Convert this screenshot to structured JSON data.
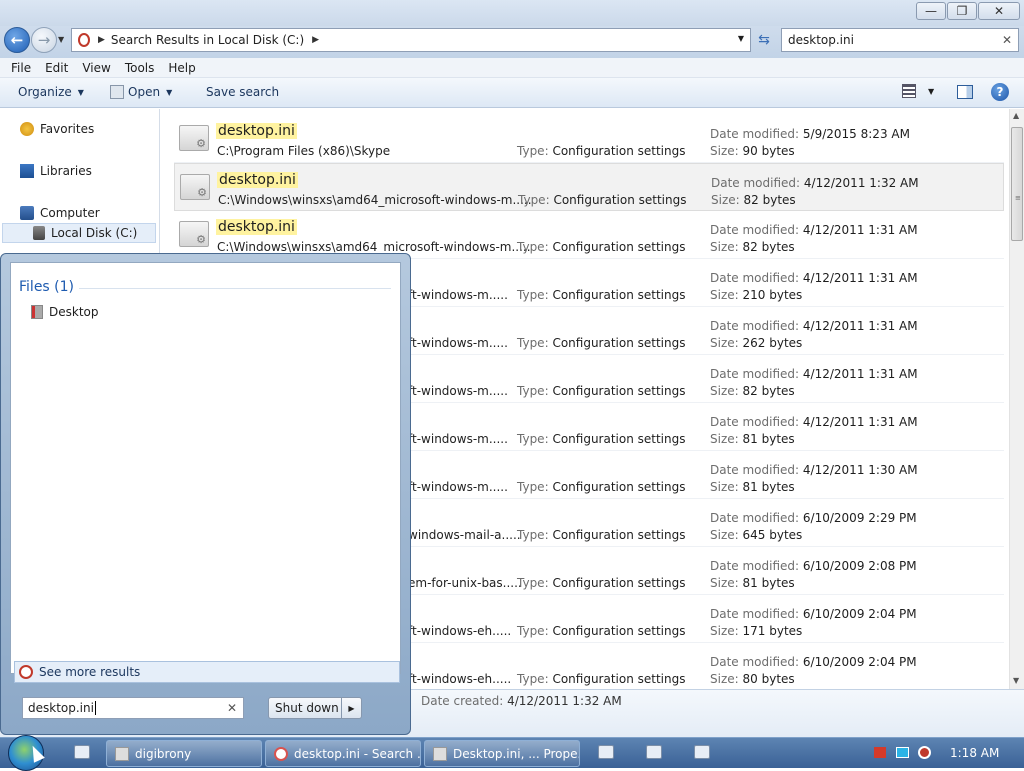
{
  "window": {
    "title_buttons": {
      "minimize": "—",
      "maximize": "❐",
      "close": "✕"
    }
  },
  "address": {
    "path": "Search Results in Local Disk (C:)",
    "search_value": "desktop.ini"
  },
  "menu": [
    "File",
    "Edit",
    "View",
    "Tools",
    "Help"
  ],
  "toolbar": {
    "organize": "Organize",
    "open": "Open",
    "save_search": "Save search"
  },
  "nav": {
    "favorites": "Favorites",
    "libraries": "Libraries",
    "computer": "Computer",
    "local_disk": "Local Disk (C:)"
  },
  "results": [
    {
      "name": "desktop.ini",
      "path": "C:\\Program Files (x86)\\Skype",
      "type_label": "Type:",
      "type": "Configuration settings",
      "date_label": "Date modified:",
      "date": "5/9/2015 8:23 AM",
      "size_label": "Size:",
      "size": "90 bytes"
    },
    {
      "name": "desktop.ini",
      "path": "C:\\Windows\\winsxs\\amd64_microsoft-windows-m.....",
      "type_label": "Type:",
      "type": "Configuration settings",
      "date_label": "Date modified:",
      "date": "4/12/2011 1:32 AM",
      "size_label": "Size:",
      "size": "82 bytes"
    },
    {
      "name": "desktop.ini",
      "path": "C:\\Windows\\winsxs\\amd64_microsoft-windows-m.....",
      "type_label": "Type:",
      "type": "Configuration settings",
      "date_label": "Date modified:",
      "date": "4/12/2011 1:31 AM",
      "size_label": "Size:",
      "size": "82 bytes"
    },
    {
      "name": "",
      "path": "ft-windows-m.....",
      "type_label": "Type:",
      "type": "Configuration settings",
      "date_label": "Date modified:",
      "date": "4/12/2011 1:31 AM",
      "size_label": "Size:",
      "size": "210 bytes"
    },
    {
      "name": "",
      "path": "ft-windows-m.....",
      "type_label": "Type:",
      "type": "Configuration settings",
      "date_label": "Date modified:",
      "date": "4/12/2011 1:31 AM",
      "size_label": "Size:",
      "size": "262 bytes"
    },
    {
      "name": "",
      "path": "ft-windows-m.....",
      "type_label": "Type:",
      "type": "Configuration settings",
      "date_label": "Date modified:",
      "date": "4/12/2011 1:31 AM",
      "size_label": "Size:",
      "size": "82 bytes"
    },
    {
      "name": "",
      "path": "ft-windows-m.....",
      "type_label": "Type:",
      "type": "Configuration settings",
      "date_label": "Date modified:",
      "date": "4/12/2011 1:31 AM",
      "size_label": "Size:",
      "size": "81 bytes"
    },
    {
      "name": "",
      "path": "ft-windows-m.....",
      "type_label": "Type:",
      "type": "Configuration settings",
      "date_label": "Date modified:",
      "date": "4/12/2011 1:30 AM",
      "size_label": "Size:",
      "size": "81 bytes"
    },
    {
      "name": "",
      "path": "windows-mail-a.....",
      "type_label": "Type:",
      "type": "Configuration settings",
      "date_label": "Date modified:",
      "date": "6/10/2009 2:29 PM",
      "size_label": "Size:",
      "size": "645 bytes"
    },
    {
      "name": "",
      "path": "em-for-unix-bas.....",
      "type_label": "Type:",
      "type": "Configuration settings",
      "date_label": "Date modified:",
      "date": "6/10/2009 2:08 PM",
      "size_label": "Size:",
      "size": "81 bytes"
    },
    {
      "name": "",
      "path": "ft-windows-eh.....",
      "type_label": "Type:",
      "type": "Configuration settings",
      "date_label": "Date modified:",
      "date": "6/10/2009 2:04 PM",
      "size_label": "Size:",
      "size": "171 bytes"
    },
    {
      "name": "",
      "path": "ft-windows-eh.....",
      "type_label": "Type:",
      "type": "Configuration settings",
      "date_label": "Date modified:",
      "date": "6/10/2009 2:04 PM",
      "size_label": "Size:",
      "size": "80 bytes"
    }
  ],
  "details": {
    "date_created_label": "Date created:",
    "date_created": "4/12/2011 1:32 AM"
  },
  "start_menu": {
    "files_header": "Files (1)",
    "item": "Desktop",
    "see_more": "See more results",
    "search_value": "desktop.ini",
    "shutdown": "Shut down"
  },
  "taskbar": {
    "tasks": [
      "digibrony",
      "desktop.ini - Search ...",
      "Desktop.ini, ... Prope..."
    ],
    "clock": "1:18 AM"
  },
  "colors": {
    "highlight": "#fff3a0",
    "accent": "#1e5bb0"
  }
}
